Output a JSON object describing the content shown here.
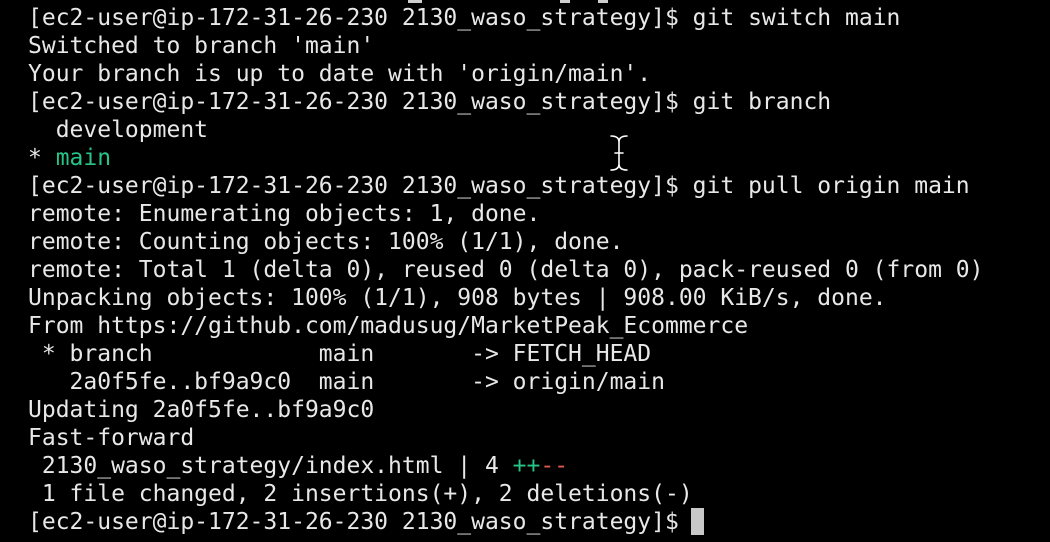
{
  "terminal": {
    "lines": [
      {
        "prefix": "[ec2-user@ip-172-31-26-230 2130_waso_strategy]$",
        "command": " git switch main"
      },
      {
        "text": "Switched to branch 'main'"
      },
      {
        "text": "Your branch is up to date with 'origin/main'."
      },
      {
        "prefix": "[ec2-user@ip-172-31-26-230 2130_waso_strategy]$",
        "command": " git branch"
      },
      {
        "text": "  development"
      },
      {
        "marker": "* ",
        "branch": "main"
      },
      {
        "prefix": "[ec2-user@ip-172-31-26-230 2130_waso_strategy]$",
        "command": " git pull origin main"
      },
      {
        "text": "remote: Enumerating objects: 1, done."
      },
      {
        "text": "remote: Counting objects: 100% (1/1), done."
      },
      {
        "text": "remote: Total 1 (delta 0), reused 0 (delta 0), pack-reused 0 (from 0)"
      },
      {
        "text": "Unpacking objects: 100% (1/1), 908 bytes | 908.00 KiB/s, done."
      },
      {
        "text": "From https://github.com/madusug/MarketPeak_Ecommerce"
      },
      {
        "text": " * branch            main       -> FETCH_HEAD"
      },
      {
        "text": "   2a0f5fe..bf9a9c0  main       -> origin/main"
      },
      {
        "text": "Updating 2a0f5fe..bf9a9c0"
      },
      {
        "text": "Fast-forward"
      },
      {
        "stat": " 2130_waso_strategy/index.html | 4 ",
        "plus": "++",
        "minus": "--"
      },
      {
        "text": " 1 file changed, 2 insertions(+), 2 deletions(-)"
      },
      {
        "prefix": "[ec2-user@ip-172-31-26-230 2130_waso_strategy]$",
        "command": ""
      }
    ]
  },
  "colors": {
    "background": "#000000",
    "foreground": "#e8e8e8",
    "branch_current": "#27c387",
    "insertions": "#27c387",
    "deletions": "#e2574f",
    "cursor": "#c8c8c8"
  },
  "icons": {
    "mouse_pointer": "i-beam-cursor-icon",
    "text_cursor": "block-cursor"
  }
}
